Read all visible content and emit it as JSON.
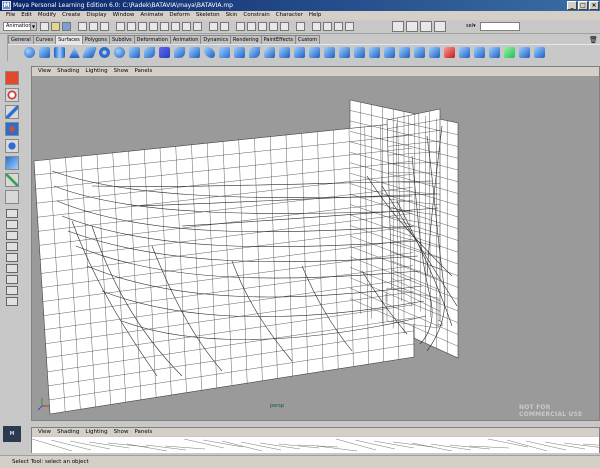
{
  "title": "Maya Personal Learning Edition 6.0: C:\\Radek\\BATAVIA\\maya\\BATAVIA.mp",
  "menu": [
    "File",
    "Edit",
    "Modify",
    "Create",
    "Display",
    "Window",
    "Animate",
    "Deform",
    "Skeleton",
    "Skin",
    "Constrain",
    "Character",
    "Help"
  ],
  "mode": "Animation",
  "shelf_tabs": [
    "General",
    "Curves",
    "Surfaces",
    "Polygons",
    "Subdivs",
    "Deformation",
    "Animation",
    "Dynamics",
    "Rendering",
    "PaintEffects",
    "Custom"
  ],
  "active_shelf_tab": "Surfaces",
  "panel_menu": [
    "View",
    "Shading",
    "Lighting",
    "Show",
    "Panels"
  ],
  "camera_label": "persp",
  "watermark": "NOT FOR COMMERCIAL USE",
  "help_text": "Select Tool: select an object",
  "colors": {
    "title_bar": "#0a246a",
    "viewport_bg": "#9a9a9a",
    "active_tool": "#e04a2a",
    "shelf_icon": "#2a6fd0"
  },
  "icons": [
    "maya-logo-icon",
    "minimize-icon",
    "maximize-icon",
    "close-icon",
    "select-tool-icon",
    "lasso-tool-icon",
    "move-tool-icon",
    "rotate-tool-icon",
    "scale-tool-icon",
    "trash-icon"
  ]
}
